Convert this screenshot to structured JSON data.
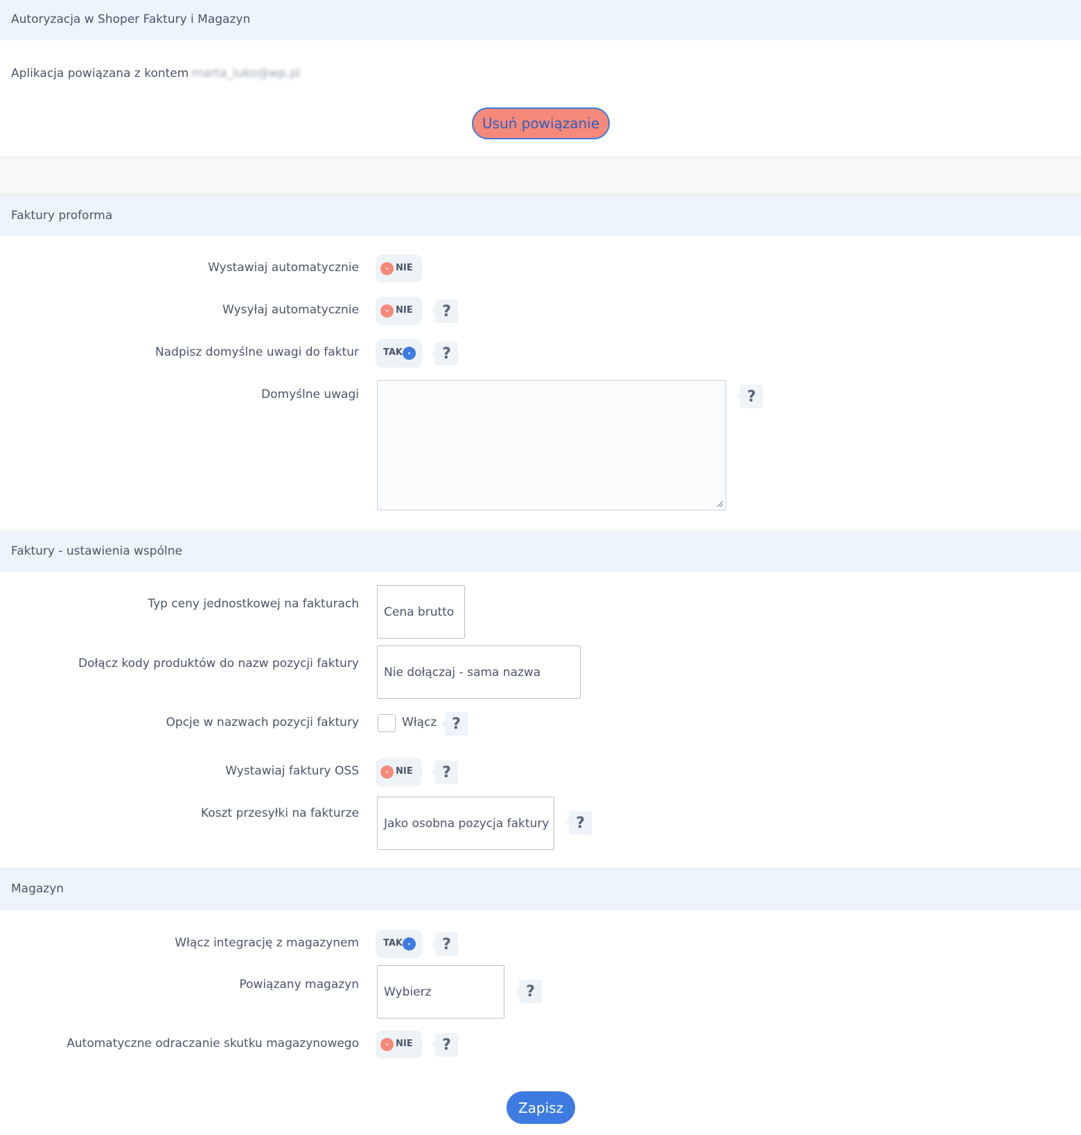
{
  "auth": {
    "title": "Autoryzacja w Shoper Faktury i Magazyn",
    "account_prefix": "Aplikacja powiązana z kontem",
    "account_email": "marta_luko@wp.pl",
    "unlink_label": "Usuń powiązanie"
  },
  "proforma": {
    "title": "Faktury proforma",
    "auto_issue": {
      "label": "Wystawiaj automatycznie",
      "state": "NIE"
    },
    "auto_send": {
      "label": "Wysyłaj automatycznie",
      "state": "NIE"
    },
    "override_notes": {
      "label": "Nadpisz domyślne uwagi do faktur",
      "state": "TAK"
    },
    "default_notes": {
      "label": "Domyślne uwagi",
      "value": ""
    }
  },
  "common": {
    "title": "Faktury - ustawienia wspólne",
    "price_type": {
      "label": "Typ ceny jednostkowej na fakturach",
      "value": "Cena brutto"
    },
    "product_codes": {
      "label": "Dołącz kody produktów do nazw pozycji faktury",
      "value": "Nie dołączaj - sama nazwa"
    },
    "options_in_names": {
      "label": "Opcje w nazwach pozycji faktury",
      "checkbox_label": "Włącz"
    },
    "oss": {
      "label": "Wystawiaj faktury OSS",
      "state": "NIE"
    },
    "shipping_cost": {
      "label": "Koszt przesyłki na fakturze",
      "value": "Jako osobna pozycja faktury"
    }
  },
  "warehouse": {
    "title": "Magazyn",
    "integration": {
      "label": "Włącz integrację z magazynem",
      "state": "TAK"
    },
    "linked": {
      "label": "Powiązany magazyn",
      "value": "Wybierz"
    },
    "defer": {
      "label": "Automatyczne odraczanie skutku magazynowego",
      "state": "NIE"
    }
  },
  "help_glyph": "?",
  "save_label": "Zapisz",
  "colors": {
    "accent": "#3d7be0",
    "off": "#f5897a",
    "band": "#eef4fb"
  }
}
